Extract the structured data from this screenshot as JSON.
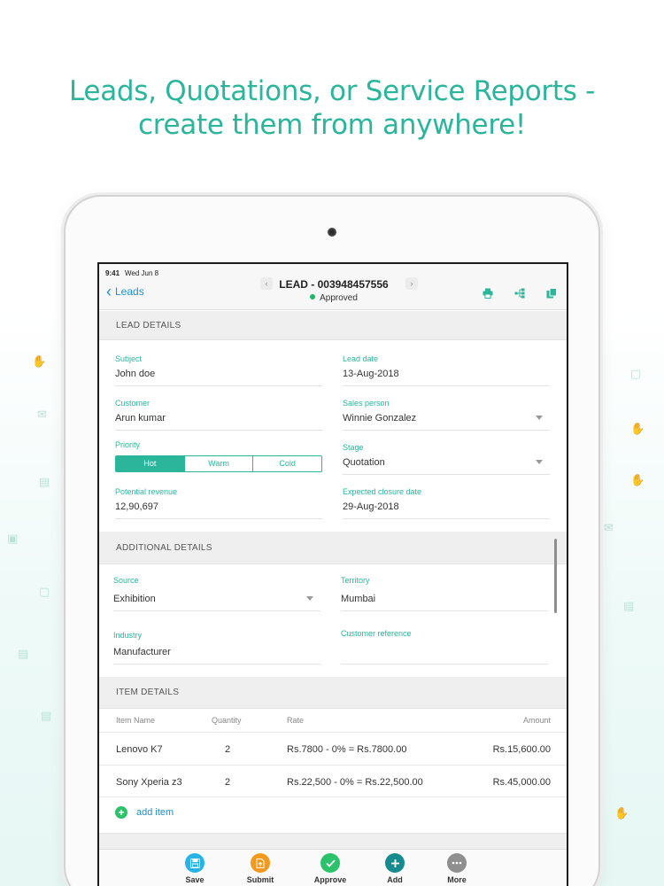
{
  "headline": {
    "line1": "Leads, Quotations, or Service Reports -",
    "line2": "create them from anywhere!"
  },
  "statusbar": {
    "time": "9:41",
    "date": "Wed Jun 8"
  },
  "nav": {
    "back_label": "Leads",
    "title": "LEAD - 003948457556",
    "status": "Approved",
    "prev_arrow": "‹",
    "next_arrow": "›"
  },
  "lead_details": {
    "header": "LEAD DETAILS",
    "subject": {
      "label": "Subject",
      "value": "John doe"
    },
    "lead_date": {
      "label": "Lead date",
      "value": "13-Aug-2018"
    },
    "customer": {
      "label": "Customer",
      "value": "Arun kumar"
    },
    "sales_person": {
      "label": "Sales person",
      "value": "Winnie Gonzalez"
    },
    "priority": {
      "label": "Priority",
      "options": [
        "Hot",
        "Warm",
        "Cold"
      ],
      "selected": "Hot"
    },
    "stage": {
      "label": "Stage",
      "value": "Quotation"
    },
    "potential_revenue": {
      "label": "Potential revenue",
      "value": "12,90,697"
    },
    "expected_closure": {
      "label": "Expected closure date",
      "value": "29-Aug-2018"
    }
  },
  "additional_details": {
    "header": "ADDITIONAL DETAILS",
    "source": {
      "label": "Source",
      "value": "Exhibition"
    },
    "territory": {
      "label": "Territory",
      "value": "Mumbai"
    },
    "industry": {
      "label": "Industry",
      "value": "Manufacturer"
    },
    "customer_reference": {
      "label": "Customer reference",
      "value": ""
    }
  },
  "item_details": {
    "header": "ITEM DETAILS",
    "columns": {
      "name": "Item Name",
      "quantity": "Quantity",
      "rate": "Rate",
      "amount": "Amount"
    },
    "rows": [
      {
        "name": "Lenovo K7",
        "quantity": "2",
        "rate": "Rs.7800 - 0%  =  Rs.7800.00",
        "amount": "Rs.15,600.00"
      },
      {
        "name": "Sony Xperia z3",
        "quantity": "2",
        "rate": "Rs.22,500 - 0%  =  Rs.22,500.00",
        "amount": "Rs.45,000.00"
      }
    ],
    "add_label": "add item"
  },
  "toolbar": {
    "save": "Save",
    "submit": "Submit",
    "approve": "Approve",
    "add": "Add",
    "more": "More"
  },
  "colors": {
    "accent": "#2bb59b",
    "link": "#1a8fd1",
    "approved": "#20b868",
    "save": "#27b3e6",
    "submit": "#f39a1e",
    "approve": "#2bc26b",
    "add": "#158a8f",
    "more": "#8f8f8f"
  }
}
